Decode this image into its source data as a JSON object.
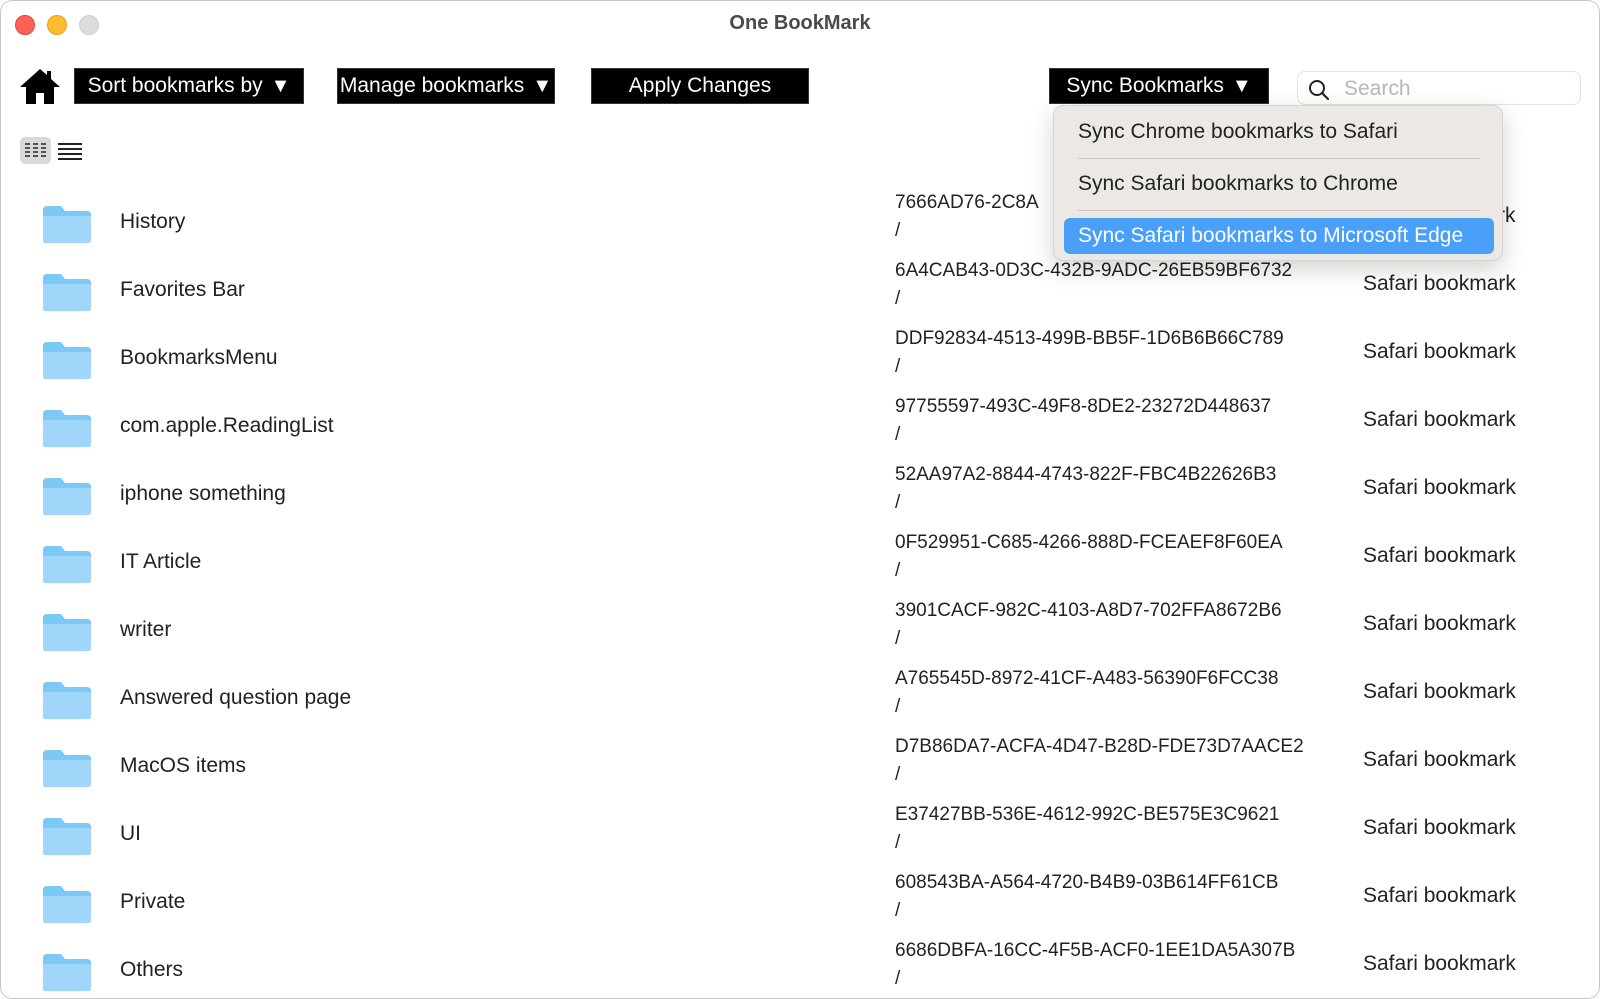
{
  "window": {
    "title": "One BookMark"
  },
  "toolbar": {
    "sort_label": "Sort bookmarks by",
    "manage_label": "Manage bookmarks",
    "apply_label": "Apply Changes",
    "sync_label": "Sync Bookmarks",
    "caret": "▼"
  },
  "search": {
    "placeholder": "Search",
    "value": ""
  },
  "sync_menu": {
    "items": [
      {
        "label": "Sync Chrome bookmarks to Safari",
        "selected": false
      },
      {
        "label": "Sync Safari bookmarks to Chrome",
        "selected": false
      },
      {
        "label": "Sync Safari bookmarks to Microsoft Edge",
        "selected": true
      }
    ]
  },
  "bookmarks": [
    {
      "name": "History",
      "id": "7666AD76-2C8A",
      "path": "/",
      "type": "rk"
    },
    {
      "name": "Favorites Bar",
      "id": "6A4CAB43-0D3C-432B-9ADC-26EB59BF6732",
      "path": "/",
      "type": "Safari bookmark"
    },
    {
      "name": "BookmarksMenu",
      "id": "DDF92834-4513-499B-BB5F-1D6B6B66C789",
      "path": "/",
      "type": "Safari bookmark"
    },
    {
      "name": "com.apple.ReadingList",
      "id": "97755597-493C-49F8-8DE2-23272D448637",
      "path": "/",
      "type": "Safari bookmark"
    },
    {
      "name": "iphone something",
      "id": "52AA97A2-8844-4743-822F-FBC4B22626B3",
      "path": "/",
      "type": "Safari bookmark"
    },
    {
      "name": "IT Article",
      "id": "0F529951-C685-4266-888D-FCEAEF8F60EA",
      "path": "/",
      "type": "Safari bookmark"
    },
    {
      "name": "writer",
      "id": "3901CACF-982C-4103-A8D7-702FFA8672B6",
      "path": "/",
      "type": "Safari bookmark"
    },
    {
      "name": "Answered question page",
      "id": "A765545D-8972-41CF-A483-56390F6FCC38",
      "path": "/",
      "type": "Safari bookmark"
    },
    {
      "name": "MacOS items",
      "id": "D7B86DA7-ACFA-4D47-B28D-FDE73D7AACE2",
      "path": "/",
      "type": "Safari bookmark"
    },
    {
      "name": "UI",
      "id": "E37427BB-536E-4612-992C-BE575E3C9621",
      "path": "/",
      "type": "Safari bookmark"
    },
    {
      "name": "Private",
      "id": "608543BA-A564-4720-B4B9-03B614FF61CB",
      "path": "/",
      "type": "Safari bookmark"
    },
    {
      "name": "Others",
      "id": "6686DBFA-16CC-4F5B-ACF0-1EE1DA5A307B",
      "path": "/",
      "type": "Safari bookmark"
    }
  ],
  "colors": {
    "folder": "#7cc8f7",
    "menu_selected": "#4a9ff8",
    "button_bg": "#000000"
  },
  "icons": {
    "home": "home-icon",
    "search": "search-icon",
    "grid_view": "grid-view-icon",
    "list_view": "list-view-icon",
    "folder": "folder-icon"
  }
}
